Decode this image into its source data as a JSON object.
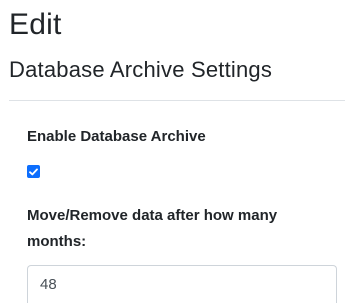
{
  "page": {
    "title": "Edit",
    "subtitle": "Database Archive Settings"
  },
  "form": {
    "enable_archive": {
      "label": "Enable Database Archive",
      "checked": true
    },
    "months": {
      "label": "Move/Remove data after how many months:",
      "value": "48"
    }
  },
  "colors": {
    "accent": "#0d6efd",
    "text": "#212529",
    "divider": "#dee2e6",
    "input_border": "#ced4da"
  }
}
